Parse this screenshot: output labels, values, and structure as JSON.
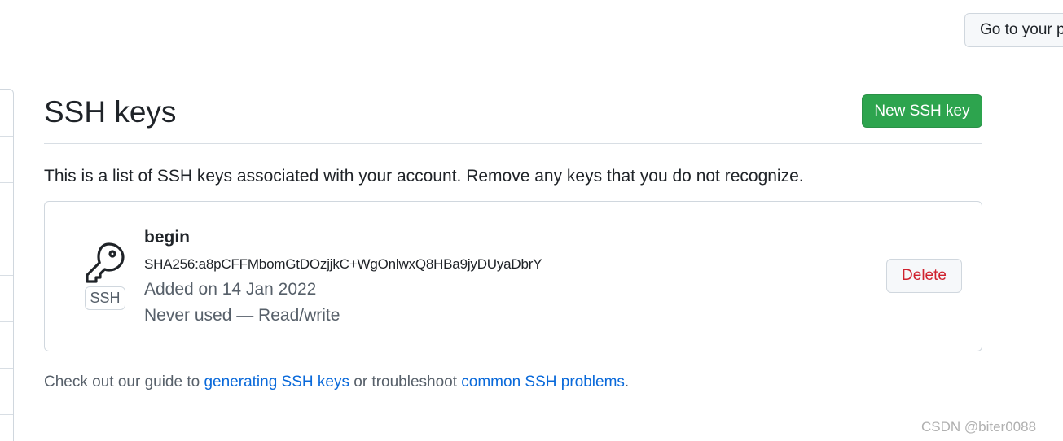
{
  "header": {
    "profile_button_label": "Go to your p"
  },
  "main": {
    "title": "SSH keys",
    "new_key_button_label": "New SSH key",
    "intro": "This is a list of SSH keys associated with your account. Remove any keys that you do not recognize."
  },
  "key": {
    "type_badge": "SSH",
    "icon": "key-icon",
    "name": "begin",
    "fingerprint": "SHA256:a8pCFFMbomGtDOzjjkC+WgOnlwxQ8HBa9jyDUyaDbrY",
    "added": "Added on 14 Jan 2022",
    "usage": "Never used — Read/write",
    "delete_label": "Delete"
  },
  "help": {
    "prefix": "Check out our guide to ",
    "link1": "generating SSH keys",
    "middle": " or troubleshoot ",
    "link2": "common SSH problems",
    "suffix": "."
  },
  "watermark": "CSDN @biter0088",
  "colors": {
    "primary_button": "#2da44e",
    "danger": "#cf222e",
    "link": "#0969da",
    "muted_text": "#57606a",
    "border": "#d0d7de"
  }
}
